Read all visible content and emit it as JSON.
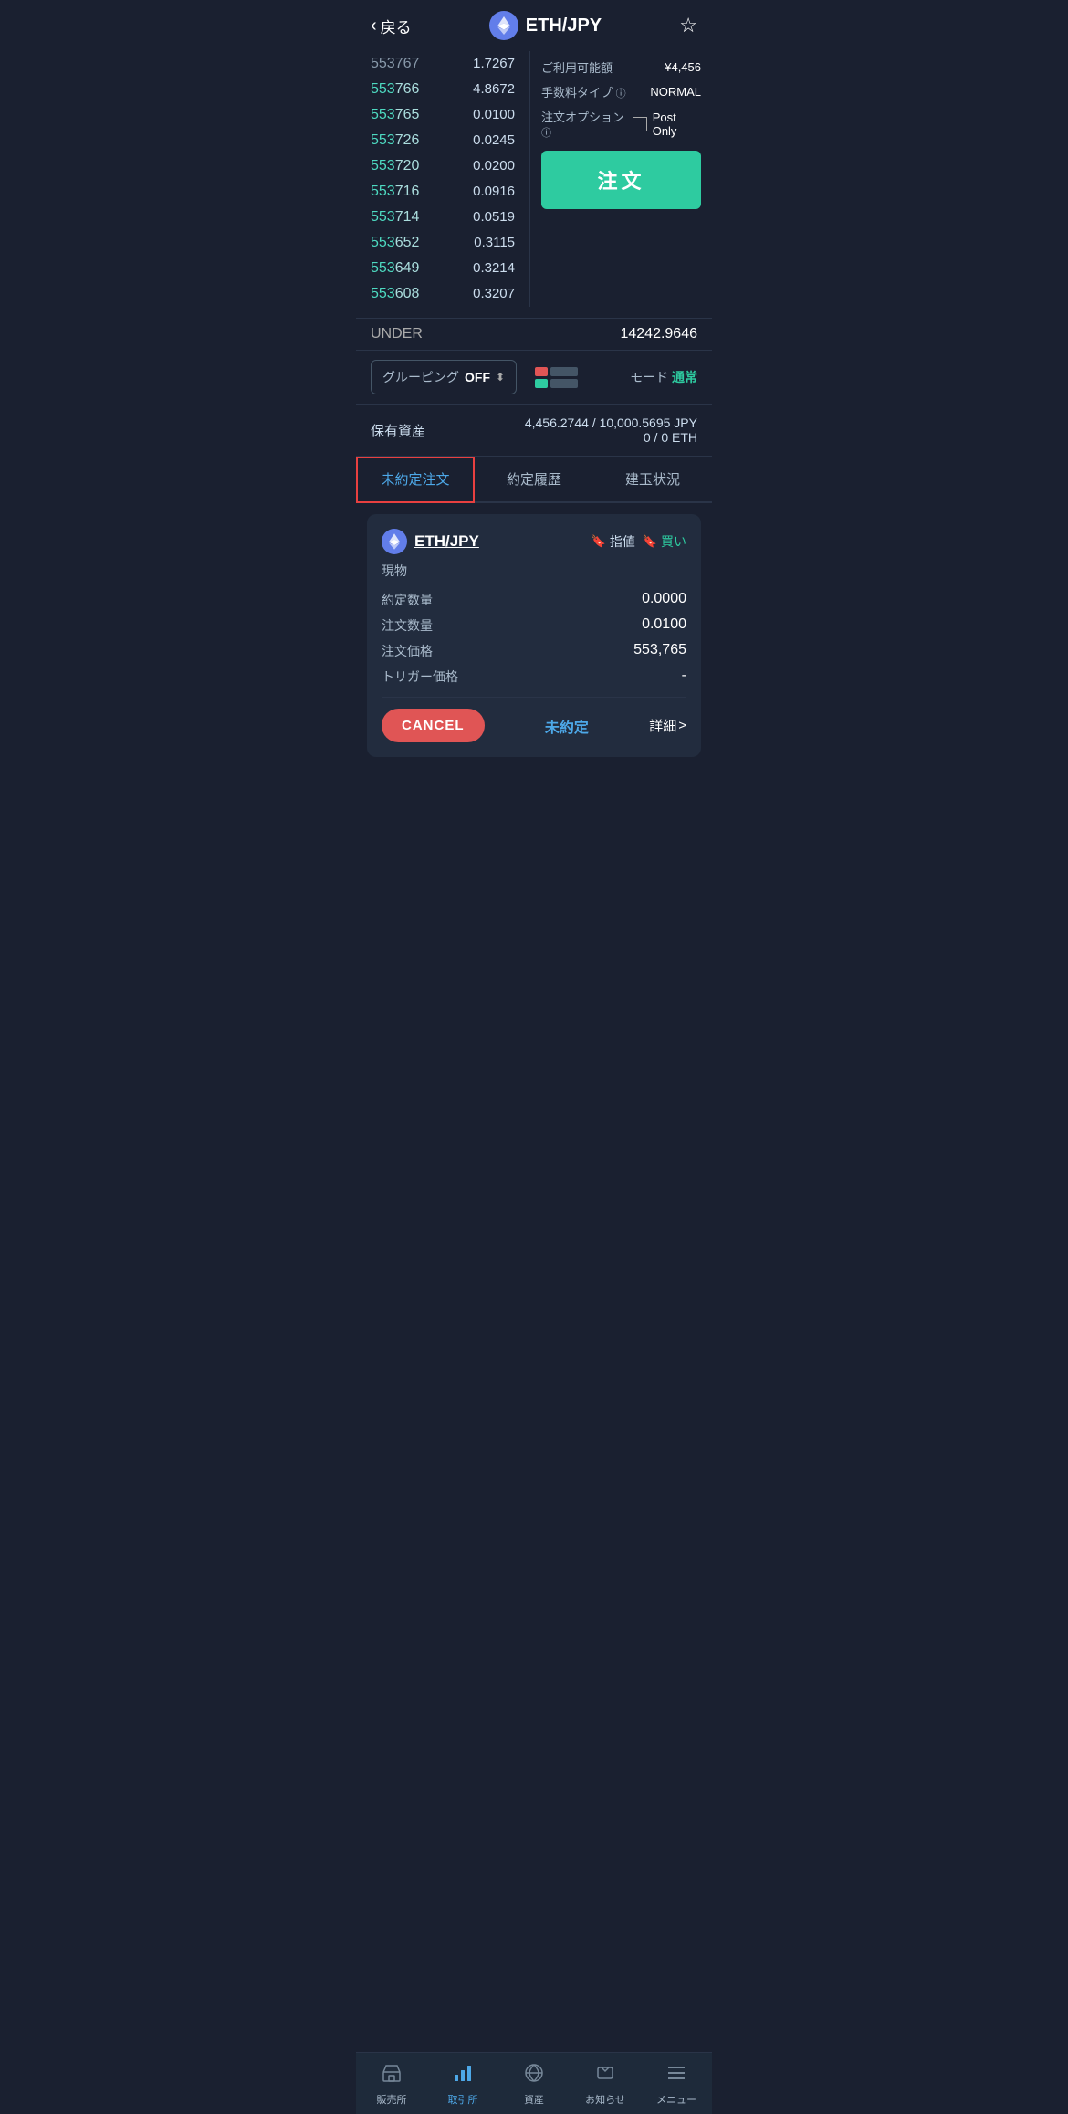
{
  "header": {
    "back_label": "戻る",
    "pair": "ETH/JPY",
    "star_icon": "☆"
  },
  "orderbook": {
    "rows": [
      {
        "price_prefix": "553",
        "price_suffix": "767",
        "qty": "1.7267"
      },
      {
        "price_prefix": "553",
        "price_suffix": "766",
        "qty": "4.8672"
      },
      {
        "price_prefix": "553",
        "price_suffix": "765",
        "qty": "0.0100"
      },
      {
        "price_prefix": "553",
        "price_suffix": "726",
        "qty": "0.0245"
      },
      {
        "price_prefix": "553",
        "price_suffix": "720",
        "qty": "0.0200"
      },
      {
        "price_prefix": "553",
        "price_suffix": "716",
        "qty": "0.0916"
      },
      {
        "price_prefix": "553",
        "price_suffix": "714",
        "qty": "0.0519"
      },
      {
        "price_prefix": "553",
        "price_suffix": "652",
        "qty": "0.3115"
      },
      {
        "price_prefix": "553",
        "price_suffix": "649",
        "qty": "0.3214"
      },
      {
        "price_prefix": "553",
        "price_suffix": "608",
        "qty": "0.3207"
      }
    ],
    "under_label": "UNDER",
    "under_value": "14242.9646"
  },
  "right_panel": {
    "available_label": "ご利用可能額",
    "available_value": "¥4,456",
    "fee_label": "手数料タイプ",
    "fee_info_icon": "ⓘ",
    "fee_value": "NORMAL",
    "order_option_label": "注文オプション",
    "order_option_info_icon": "ⓘ",
    "post_only_label": "Post Only",
    "order_btn_label": "注文"
  },
  "controls": {
    "grouping_label": "グルーピング",
    "grouping_value": "OFF",
    "mode_label": "モード",
    "mode_value": "通常"
  },
  "assets": {
    "label": "保有資産",
    "jpy_value": "4,456.2744 / 10,000.5695  JPY",
    "eth_value": "0 / 0  ETH"
  },
  "tabs": [
    {
      "label": "未約定注文",
      "active": true
    },
    {
      "label": "約定履歴",
      "active": false
    },
    {
      "label": "建玉状況",
      "active": false
    }
  ],
  "order_card": {
    "pair": "ETH/JPY",
    "type_tag": "指値",
    "direction_tag": "買い",
    "order_type": "現物",
    "fields": [
      {
        "label": "約定数量",
        "value": "0.0000"
      },
      {
        "label": "注文数量",
        "value": "0.0100"
      },
      {
        "label": "注文価格",
        "value": "553,765"
      },
      {
        "label": "トリガー価格",
        "value": "-"
      }
    ],
    "cancel_label": "CANCEL",
    "status_label": "未約定",
    "detail_label": "詳細",
    "detail_arrow": ">"
  },
  "bottom_nav": {
    "items": [
      {
        "label": "販売所",
        "icon": "🏪",
        "active": false
      },
      {
        "label": "取引所",
        "icon": "📊",
        "active": true
      },
      {
        "label": "資産",
        "icon": "🌐",
        "active": false
      },
      {
        "label": "お知らせ",
        "icon": "💬",
        "active": false
      },
      {
        "label": "メニュー",
        "icon": "☰",
        "active": false
      }
    ]
  }
}
